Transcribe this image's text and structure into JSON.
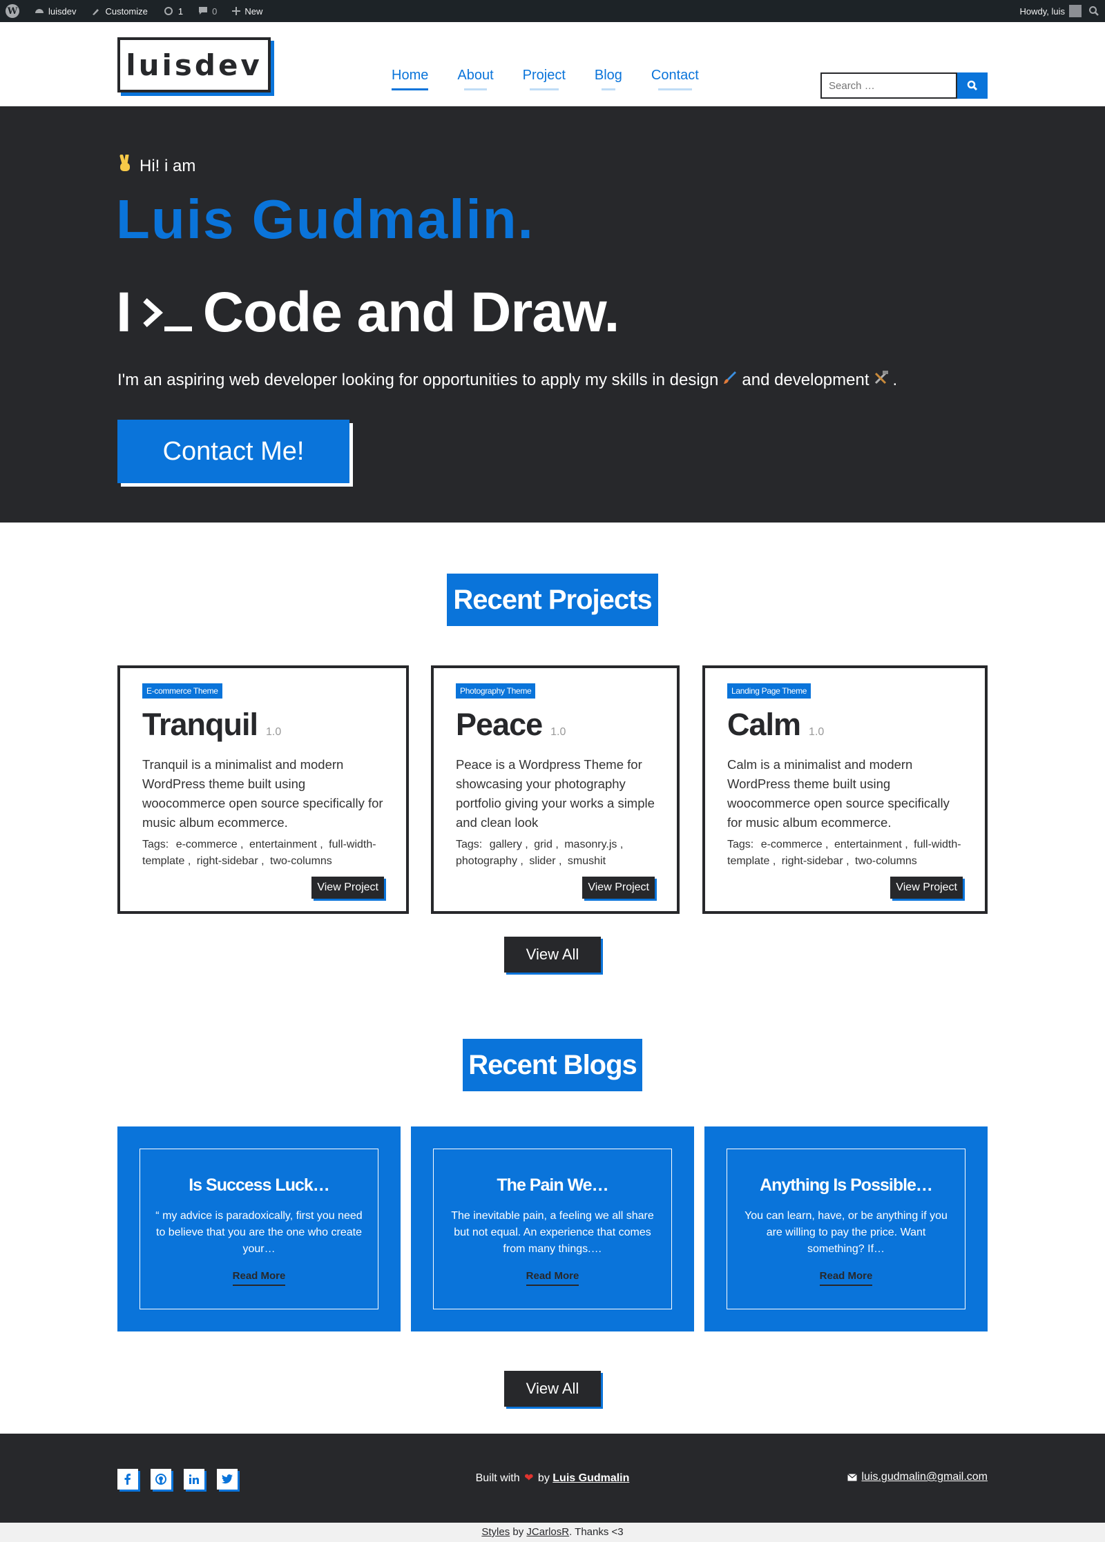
{
  "adminbar": {
    "site_name": "luisdev",
    "customize": "Customize",
    "updates_count": "1",
    "comments_count": "0",
    "new_label": "New",
    "howdy": "Howdy, luis"
  },
  "header": {
    "logo": "luisdev",
    "nav": [
      "Home",
      "About",
      "Project",
      "Blog",
      "Contact"
    ],
    "active_nav": "Home",
    "search_placeholder": "Search …"
  },
  "hero": {
    "greeting": "Hi! i am",
    "name": "Luis Gudmalin.",
    "tagline_prefix": "I",
    "tagline_suffix": "Code and Draw.",
    "intro_1": "I'm an aspiring web developer looking for opportunities to apply my skills in design",
    "intro_2": "and development",
    "intro_3": ".",
    "cta": "Contact Me!"
  },
  "projects": {
    "heading": "Recent Projects",
    "tags_label": "Tags:",
    "view_label": "View Project",
    "view_all": "View All",
    "items": [
      {
        "badge": "E-commerce Theme",
        "title": "Tranquil",
        "version": "1.0",
        "description": "Tranquil is a minimalist and modern WordPress theme built using woocommerce open source specifically for music album ecommerce.",
        "tags": [
          "e-commerce ,",
          "entertainment ,",
          "full-width-template ,",
          "right-sidebar ,",
          "two-columns"
        ]
      },
      {
        "badge": "Photography Theme",
        "title": "Peace",
        "version": "1.0",
        "description": "Peace is a Wordpress Theme for showcasing your photography portfolio giving your works a simple and clean look",
        "tags": [
          "gallery ,",
          "grid ,",
          "masonry.js ,",
          "photography ,",
          "slider ,",
          "smushit"
        ]
      },
      {
        "badge": "Landing Page Theme",
        "title": "Calm",
        "version": "1.0",
        "description": "Calm is a minimalist and modern WordPress theme built using woocommerce open source specifically for music album ecommerce.",
        "tags": [
          "e-commerce ,",
          "entertainment ,",
          "full-width-template ,",
          "right-sidebar ,",
          "two-columns"
        ]
      }
    ]
  },
  "blogs": {
    "heading": "Recent Blogs",
    "read_more": "Read More",
    "view_all": "View All",
    "items": [
      {
        "title": "Is Success Luck…",
        "excerpt": "“ my advice is paradoxically, first you need to believe that you are the one who create your…"
      },
      {
        "title": "The Pain We…",
        "excerpt": "The inevitable pain, a feeling we all share but not equal. An experience that comes from many things.…"
      },
      {
        "title": "Anything Is Possible…",
        "excerpt": "You can learn, have, or be anything if you are willing to pay the price. Want something? If…"
      }
    ]
  },
  "footer": {
    "socials": [
      "facebook-icon",
      "github-icon",
      "linkedin-icon",
      "twitter-icon"
    ],
    "built_prefix": "Built with",
    "built_by": "by",
    "author": "Luis Gudmalin",
    "email": "luis.gudmalin@gmail.com",
    "credit_styles": "Styles",
    "credit_by": "by",
    "credit_author": "JCarlosR",
    "credit_thanks": ". Thanks <3"
  },
  "colors": {
    "accent": "#0a74da",
    "dark": "#27282b",
    "adminbar": "#1d2327"
  }
}
